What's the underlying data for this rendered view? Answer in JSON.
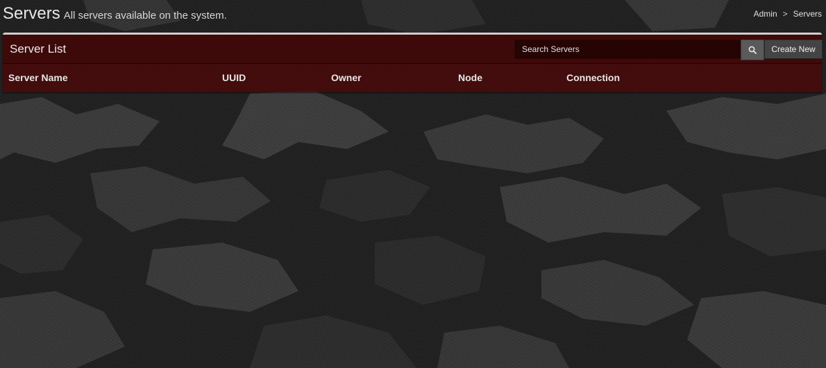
{
  "header": {
    "title": "Servers",
    "subtitle": "All servers available on the system."
  },
  "breadcrumb": {
    "items": [
      "Admin",
      "Servers"
    ],
    "separator": ">"
  },
  "panel": {
    "title": "Server List",
    "search_placeholder": "Search Servers",
    "search_icon": "search-icon",
    "create_label": "Create New",
    "columns": [
      "Server Name",
      "UUID",
      "Owner",
      "Node",
      "Connection"
    ],
    "rows": []
  },
  "colors": {
    "panel_accent": "#480a0a",
    "background": "#262626"
  }
}
